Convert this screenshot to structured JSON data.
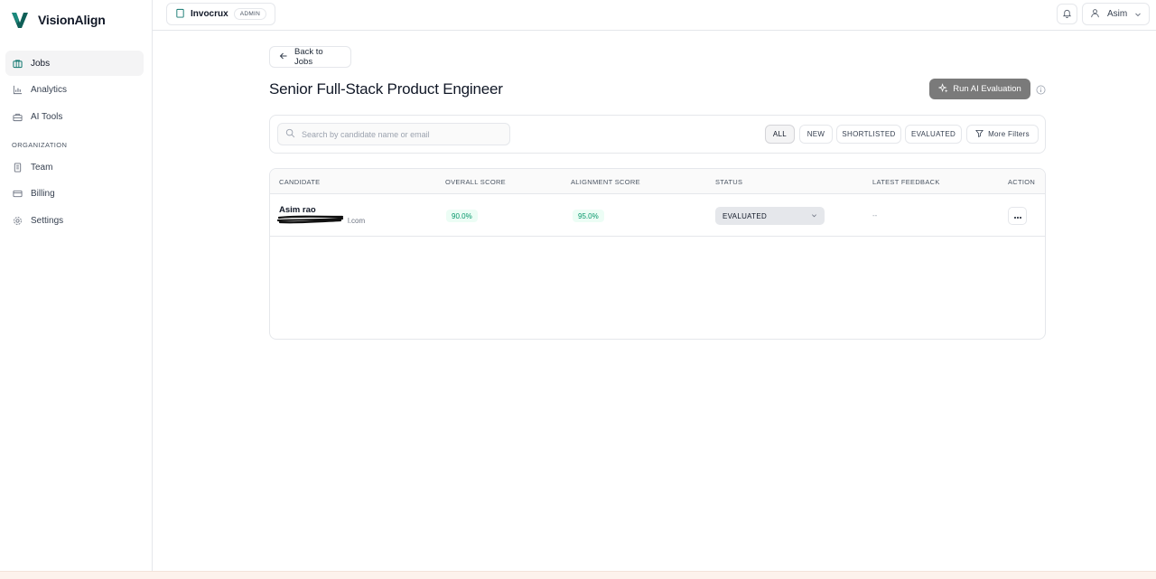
{
  "brand": {
    "name": "VisionAlign",
    "logo_icon": "brand-v-logo",
    "accent": "#0f5f57"
  },
  "sidebar": {
    "items": [
      {
        "label": "Jobs",
        "icon": "briefcase-icon",
        "active": true
      },
      {
        "label": "Analytics",
        "icon": "bar-chart-icon"
      },
      {
        "label": "AI Tools",
        "icon": "toolbox-icon"
      }
    ],
    "section_label": "ORGANIZATION",
    "org_items": [
      {
        "label": "Team",
        "icon": "building-icon"
      },
      {
        "label": "Billing",
        "icon": "credit-card-icon"
      },
      {
        "label": "Settings",
        "icon": "gear-icon"
      }
    ]
  },
  "topbar": {
    "org_name": "Invocrux",
    "role_badge": "ADMIN",
    "user_name": "Asim"
  },
  "page": {
    "back_label": "Back to Jobs",
    "title": "Senior Full-Stack Product Engineer",
    "run_ai_label": "Run AI Evaluation"
  },
  "filters": {
    "search_placeholder": "Search by candidate name or email",
    "tabs": [
      "ALL",
      "NEW",
      "SHORTLISTED",
      "EVALUATED"
    ],
    "active_tab": "ALL",
    "more_filters_label": "More Filters"
  },
  "table": {
    "columns": {
      "candidate": "CANDIDATE",
      "overall": "OVERALL SCORE",
      "alignment": "ALIGNMENT SCORE",
      "status": "STATUS",
      "feedback": "LATEST FEEDBACK",
      "action": "ACTION"
    },
    "rows": [
      {
        "name": "Asim rao",
        "email_visible": "l.com",
        "overall_score": "90.0%",
        "alignment_score": "95.0%",
        "status": "EVALUATED",
        "feedback": "--"
      }
    ]
  },
  "colors": {
    "score_bg": "#ecfdf5",
    "score_text": "#059669",
    "primary_button": "#7a7a7a"
  }
}
